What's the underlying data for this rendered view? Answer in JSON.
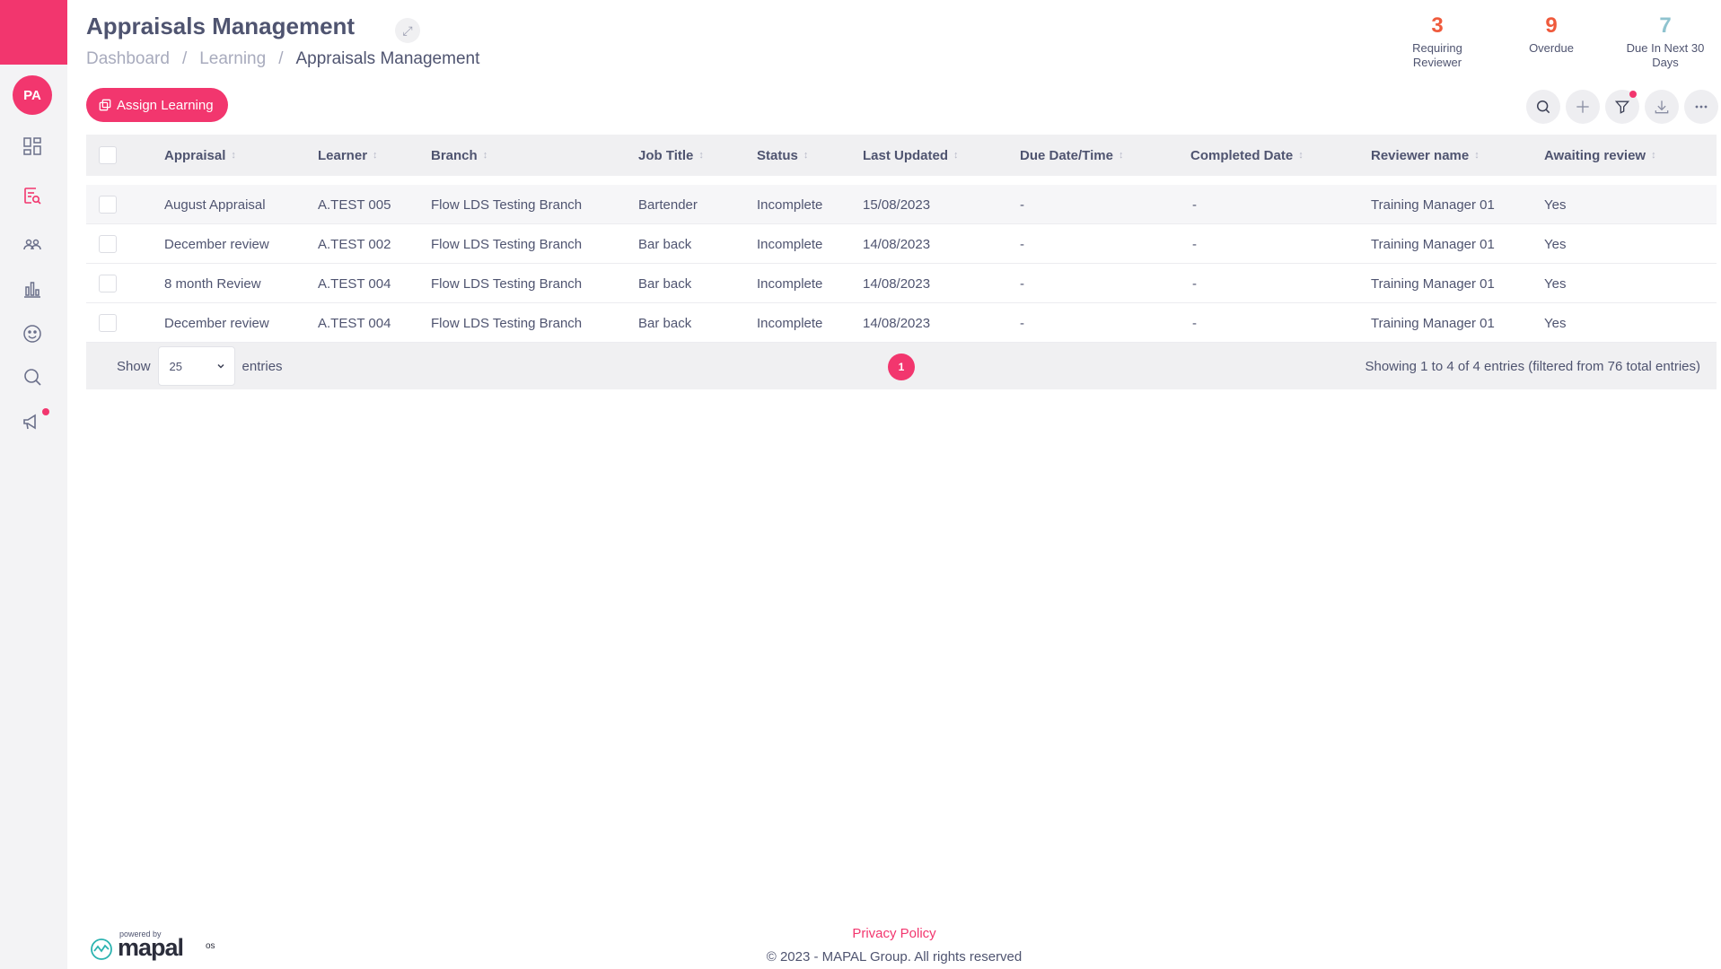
{
  "sidebar": {
    "avatar_initials": "PA",
    "icons": [
      "dashboard-icon",
      "learning-search-icon",
      "people-icon",
      "reports-icon",
      "feedback-icon",
      "search-icon",
      "announcements-icon"
    ]
  },
  "header": {
    "title": "Appraisals Management",
    "breadcrumb": [
      "Dashboard",
      "Learning",
      "Appraisals Management"
    ],
    "breadcrumb_sep": "/"
  },
  "stats": [
    {
      "value": "3",
      "label_line1": "Requiring",
      "label_line2": "Reviewer",
      "color": "#ef5a3c"
    },
    {
      "value": "9",
      "label_line1": "Overdue",
      "label_line2": "",
      "color": "#ef5a3c"
    },
    {
      "value": "7",
      "label_line1": "Due In Next 30",
      "label_line2": "Days",
      "color": "#8fc3cf"
    }
  ],
  "actions": {
    "assign_label": "Assign Learning"
  },
  "table": {
    "columns": [
      "Appraisal",
      "Learner",
      "Branch",
      "Job Title",
      "Status",
      "Last Updated",
      "Due Date/Time",
      "Completed Date",
      "Reviewer name",
      "Awaiting review"
    ],
    "rows": [
      [
        "August Appraisal",
        "A.TEST 005",
        "Flow LDS Testing Branch",
        "Bartender",
        "Incomplete",
        "15/08/2023",
        "-",
        "-",
        "Training Manager 01",
        "Yes"
      ],
      [
        "December review",
        "A.TEST 002",
        "Flow LDS Testing Branch",
        "Bar back",
        "Incomplete",
        "14/08/2023",
        "-",
        "-",
        "Training Manager 01",
        "Yes"
      ],
      [
        "8 month Review",
        "A.TEST 004",
        "Flow LDS Testing Branch",
        "Bar back",
        "Incomplete",
        "14/08/2023",
        "-",
        "-",
        "Training Manager 01",
        "Yes"
      ],
      [
        "December review",
        "A.TEST 004",
        "Flow LDS Testing Branch",
        "Bar back",
        "Incomplete",
        "14/08/2023",
        "-",
        "-",
        "Training Manager 01",
        "Yes"
      ]
    ]
  },
  "pagination": {
    "show_label": "Show",
    "page_size": "25",
    "entries_label": "entries",
    "current_page": "1",
    "info": "Showing 1 to 4 of 4 entries (filtered from 76 total entries)"
  },
  "footer": {
    "powered_by": "powered by",
    "brand": "mapal",
    "brand_suffix": "os",
    "privacy": "Privacy Policy",
    "copyright": "© 2023 - MAPAL Group. All rights reserved"
  },
  "colors": {
    "accent": "#f2366e",
    "text": "#4f5470"
  }
}
